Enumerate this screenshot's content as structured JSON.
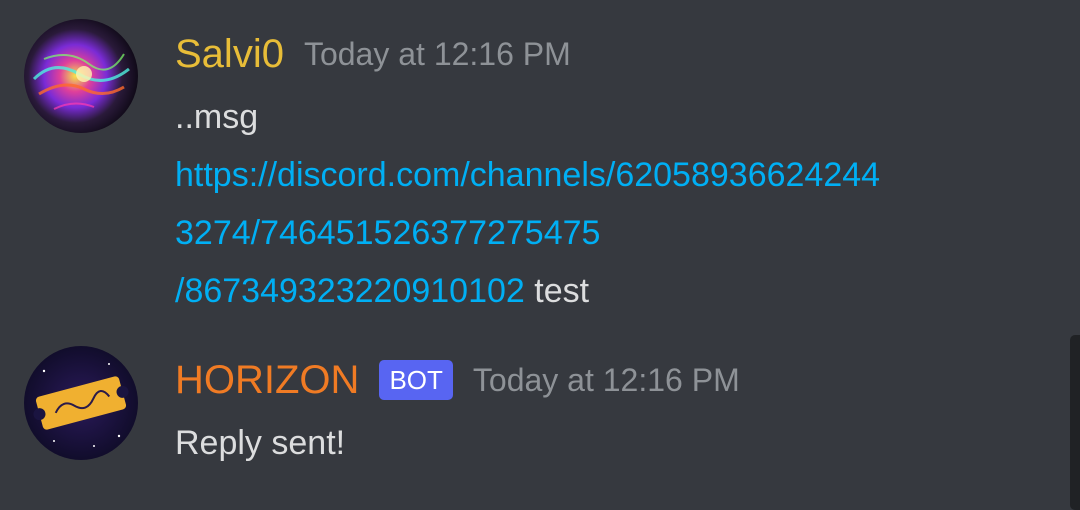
{
  "messages": [
    {
      "username": "Salvi0",
      "username_color": "#e8bd38",
      "timestamp": "Today at 12:16 PM",
      "content_line1": "..msg",
      "link_line1": "https://discord.com/channels/62058936624244",
      "link_line2": "3274/746451526377275475",
      "link_line3": "/867349323220910102",
      "trailing_text": " test",
      "avatar_icon": "nebula-avatar"
    },
    {
      "username": "HORIZON",
      "username_color": "#f07b24",
      "badge": "BOT",
      "timestamp": "Today at 12:16 PM",
      "content": "Reply sent!",
      "avatar_icon": "horizon-ticket-avatar"
    }
  ],
  "colors": {
    "background": "#36393f",
    "link": "#00aff4",
    "text": "#dcddde",
    "timestamp": "#8e9297",
    "badge": "#5865f2"
  }
}
